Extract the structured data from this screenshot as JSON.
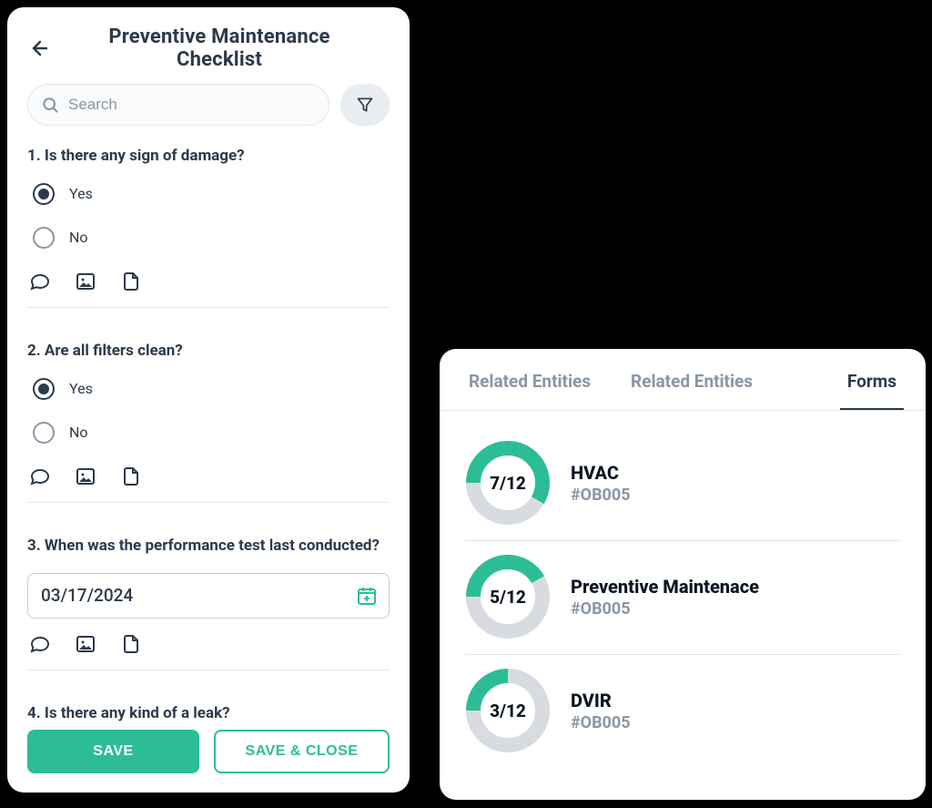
{
  "left": {
    "title": "Preventive Maintenance Checklist",
    "search_placeholder": "Search",
    "questions": [
      {
        "text": "1. Is there any sign of damage?",
        "options": [
          "Yes",
          "No"
        ],
        "selected": "Yes"
      },
      {
        "text": "2. Are all filters clean?",
        "options": [
          "Yes",
          "No"
        ],
        "selected": "Yes"
      },
      {
        "text": "3. When was the performance test last conducted?",
        "type": "date",
        "value": "03/17/2024"
      },
      {
        "text": "4. Is there any kind of a leak?"
      }
    ],
    "buttons": {
      "save": "SAVE",
      "save_close": "SAVE & CLOSE"
    }
  },
  "right": {
    "tabs": [
      "Related Entities",
      "Related Entities",
      "Forms"
    ],
    "active_tab": 2,
    "forms": [
      {
        "name": "HVAC",
        "code": "#OB005",
        "done": 7,
        "total": 12
      },
      {
        "name": "Preventive Maintenace",
        "code": "#OB005",
        "done": 5,
        "total": 12
      },
      {
        "name": "DVIR",
        "code": "#OB005",
        "done": 3,
        "total": 12
      }
    ]
  },
  "colors": {
    "teal": "#2dbd96",
    "grey_ring": "#d8dce0"
  }
}
